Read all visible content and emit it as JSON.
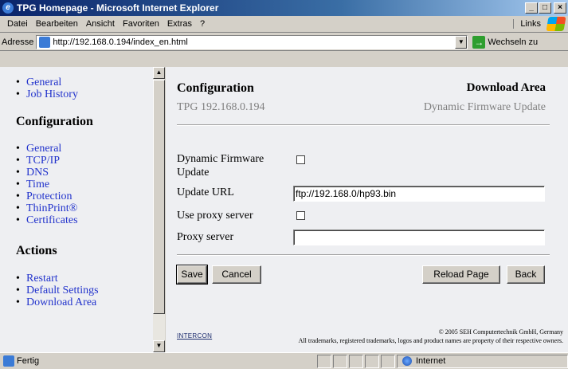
{
  "window": {
    "title": "TPG Homepage - Microsoft Internet Explorer",
    "controls": {
      "minimize": "_",
      "maximize": "□",
      "close": "×"
    }
  },
  "menubar": {
    "items": [
      "Datei",
      "Bearbeiten",
      "Ansicht",
      "Favoriten",
      "Extras",
      "?"
    ],
    "links_label": "Links"
  },
  "addressbar": {
    "label": "Adresse",
    "url": "http://192.168.0.194/index_en.html",
    "go_label": "Wechseln zu"
  },
  "nav": {
    "top_items": [
      "General",
      "Job History"
    ],
    "configuration_heading": "Configuration",
    "configuration_items": [
      "General",
      "TCP/IP",
      "DNS",
      "Time",
      "Protection",
      "ThinPrint®",
      "Certificates"
    ],
    "actions_heading": "Actions",
    "actions_items": [
      "Restart",
      "Default Settings",
      "Download Area"
    ]
  },
  "main": {
    "title": "Configuration",
    "subtitle": "TPG 192.168.0.194",
    "section_title": "Download Area",
    "section_subtitle": "Dynamic Firmware Update",
    "form": {
      "dynamic_firmware_label_line1": "Dynamic Firmware",
      "dynamic_firmware_label_line2": "Update",
      "dynamic_firmware_checked": false,
      "update_url_label": "Update URL",
      "update_url_value": "ftp://192.168.0/hp93.bin",
      "use_proxy_label": "Use proxy server",
      "use_proxy_checked": false,
      "proxy_server_label": "Proxy server",
      "proxy_server_value": ""
    },
    "buttons": {
      "save": "Save",
      "cancel": "Cancel",
      "reload": "Reload Page",
      "back": "Back"
    },
    "footer": {
      "logo": "INTERCON",
      "copyright": "© 2005 SEH Computertechnik GmbH, Germany",
      "trademarks": "All trademarks, registered trademarks, logos and product names are property of their respective owners."
    }
  },
  "statusbar": {
    "text": "Fertig",
    "zone": "Internet"
  }
}
